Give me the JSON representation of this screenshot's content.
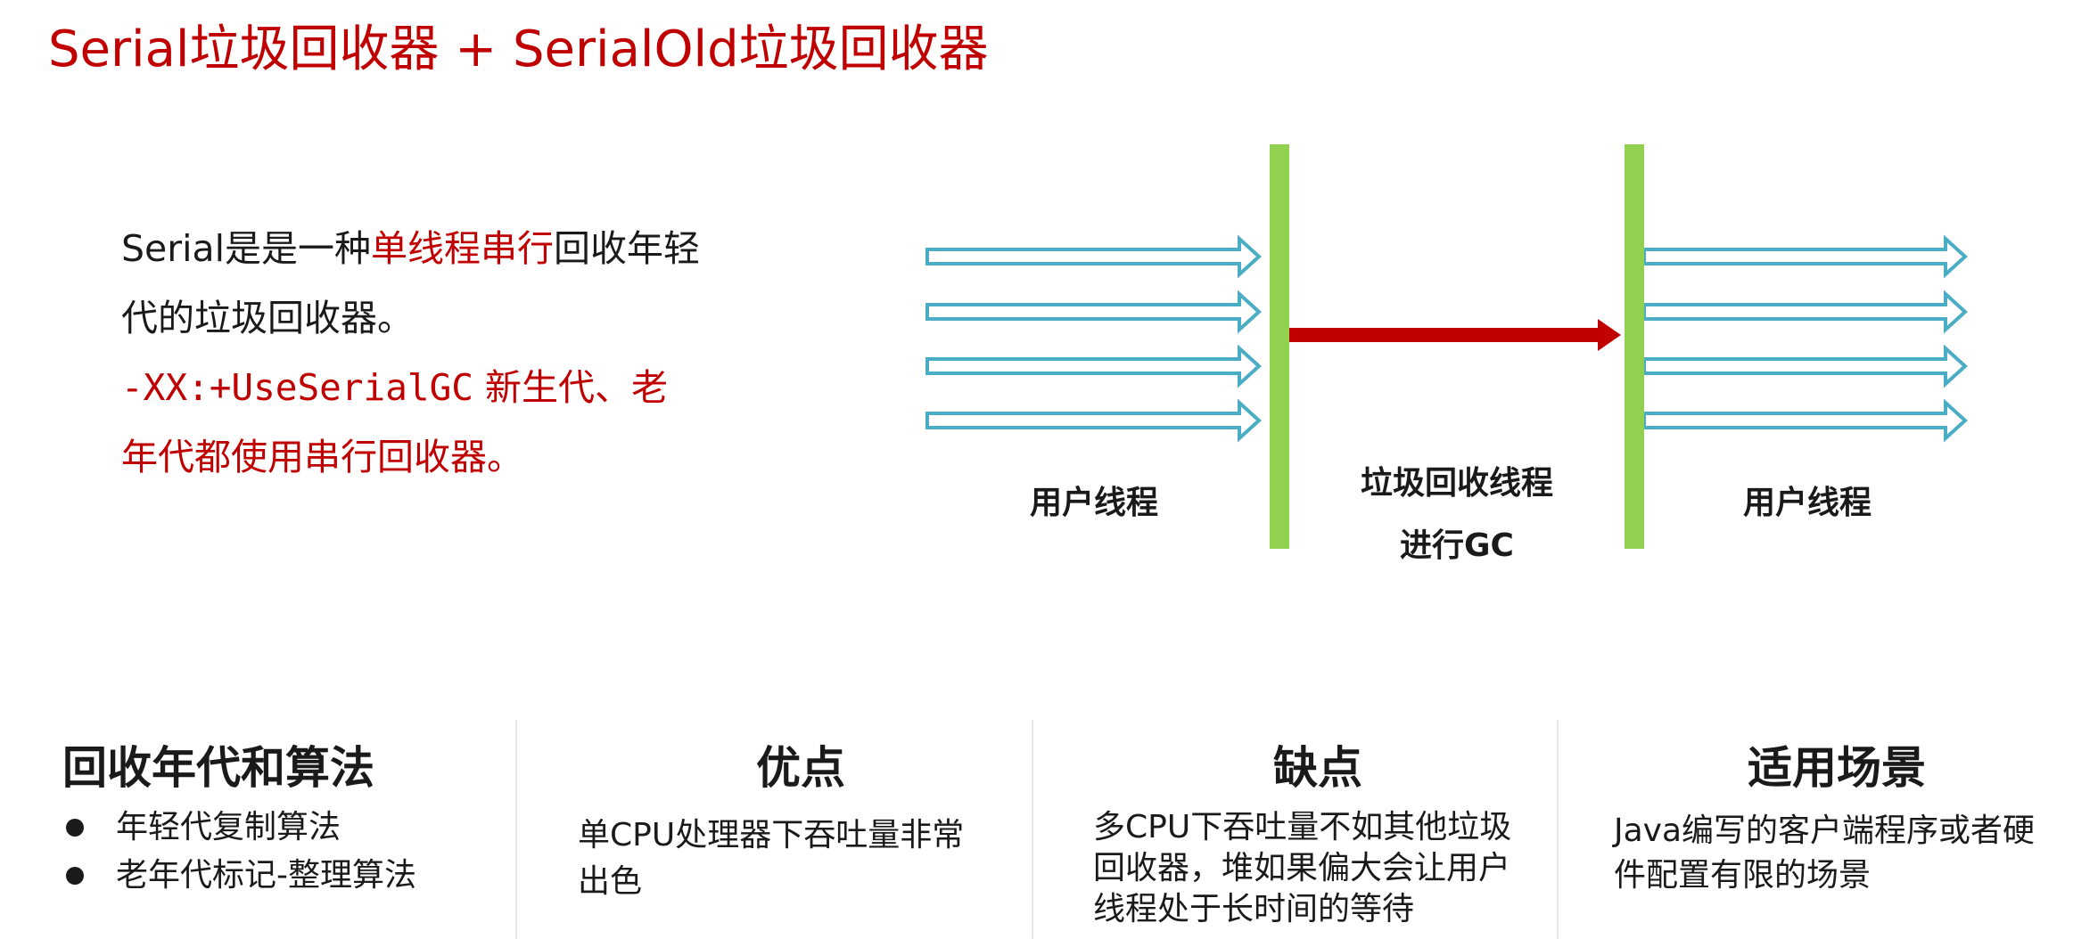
{
  "title": "Serial垃圾回收器 + SerialOld垃圾回收器",
  "intro": {
    "line1_a": "Serial是是一种",
    "line1_highlight": "单线程串行",
    "line1_b": "回收年轻",
    "line2": "代的垃圾回收器。",
    "option_flag": "-XX:+UseSerialGC",
    "option_desc_1": " 新生代、老",
    "option_desc_2": "年代都使用串行回收器。"
  },
  "diagram": {
    "left_label": "用户线程",
    "middle_label_1": "垃圾回收线程",
    "middle_label_2": "进行GC",
    "right_label": "用户线程",
    "colors": {
      "bar": "#92d050",
      "thread_arrow": "#4bacc6",
      "gc_arrow": "#c00000"
    }
  },
  "columns": {
    "algorithm": {
      "title": "回收年代和算法",
      "items": [
        "年轻代复制算法",
        "老年代标记-整理算法"
      ]
    },
    "pros": {
      "title": "优点",
      "text": "单CPU处理器下吞吐量非常出色"
    },
    "cons": {
      "title": "缺点",
      "text": "多CPU下吞吐量不如其他垃圾回收器，堆如果偏大会让用户线程处于长时间的等待"
    },
    "scenarios": {
      "title": "适用场景",
      "text": "Java编写的客户端程序或者硬件配置有限的场景"
    }
  }
}
